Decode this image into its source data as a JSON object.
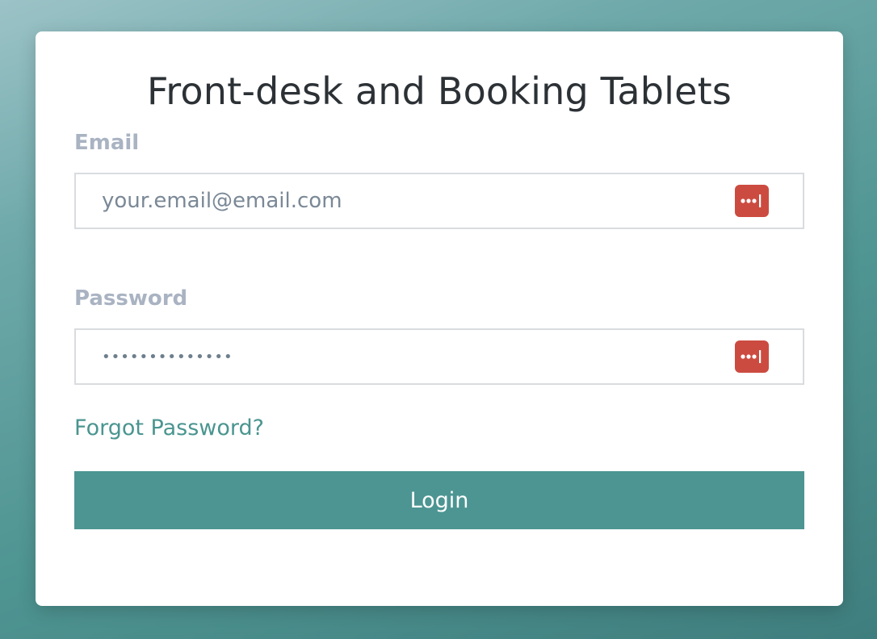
{
  "form": {
    "title": "Front-desk and Booking Tablets",
    "email_label": "Email",
    "email_placeholder": "your.email@email.com",
    "email_value": "",
    "password_label": "Password",
    "password_value": "••••••••••••••",
    "forgot_password_link": "Forgot Password?",
    "login_button": "Login"
  },
  "icons": {
    "password_manager_icon": "lastpass-dots-icon"
  },
  "colors": {
    "accent": "#4c9592",
    "password_manager_icon": "#cc4b40",
    "label": "#a9b3c2",
    "title": "#2c3136"
  }
}
